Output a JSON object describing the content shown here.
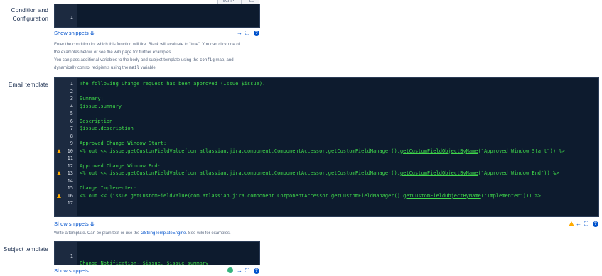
{
  "top_tabs": {
    "script": "SCRIPT",
    "file": "FILE"
  },
  "condition": {
    "label_line1": "Condition and",
    "label_line2": "Configuration",
    "line_number": "1",
    "show_snippets": "Show snippets",
    "hint_line1": "Enter the condition for which this function will fire. Blank will evaluate to \"true\". You can click one of",
    "hint_line2": "the examples below, or see the wiki page for further examples.",
    "hint_line3_pre": "You can pass additional variables to the body and subject template using the",
    "hint_line3_code": "config",
    "hint_line3_post": "map, and",
    "hint_line4_pre": "dynamically control recipients using the",
    "hint_line4_code": "mail",
    "hint_line4_post": "variable"
  },
  "email": {
    "label": "Email template",
    "lines": [
      {
        "n": "1",
        "text": "The following Change request has been approved (Issue $issue).",
        "warn": false
      },
      {
        "n": "2",
        "text": "",
        "warn": false
      },
      {
        "n": "3",
        "text": "Summary:",
        "warn": false
      },
      {
        "n": "4",
        "text": "$issue.summary",
        "warn": false
      },
      {
        "n": "5",
        "text": "",
        "warn": false
      },
      {
        "n": "6",
        "text": "Description:",
        "warn": false
      },
      {
        "n": "7",
        "text": "$issue.description",
        "warn": false
      },
      {
        "n": "8",
        "text": "",
        "warn": false
      },
      {
        "n": "9",
        "text": "Approved Change Window Start:",
        "warn": false
      },
      {
        "n": "10",
        "pre": "<% out << issue.getCustomFieldValue(com.atlassian.jira.component.ComponentAccessor.getCustomFieldManager().",
        "u": "getCustomFieldObjectByName",
        "post": "(\"Approved Window Start\")) %>",
        "warn": true
      },
      {
        "n": "11",
        "text": "",
        "warn": false
      },
      {
        "n": "12",
        "text": "Approved Change Window End:",
        "warn": false
      },
      {
        "n": "13",
        "pre": "<% out << issue.getCustomFieldValue(com.atlassian.jira.component.ComponentAccessor.getCustomFieldManager().",
        "u": "getCustomFieldObjectByName",
        "post": "(\"Approved Window End\")) %>",
        "warn": true
      },
      {
        "n": "14",
        "text": "",
        "warn": false
      },
      {
        "n": "15",
        "text": "Change Implementer:",
        "warn": false
      },
      {
        "n": "16",
        "pre": "<% out << (issue.getCustomFieldValue(com.atlassian.jira.component.ComponentAccessor.getCustomFieldManager().",
        "u": "getCustomFieldObjectByName",
        "post": "(\"Implementer\"))) %>",
        "warn": true
      },
      {
        "n": "17",
        "text": "",
        "warn": false
      }
    ],
    "show_snippets": "Show snippets",
    "hint_pre": "Write a template. Can be plain text or use the",
    "hint_link": "GStringTemplateEngine",
    "hint_post": ". See wiki for examples."
  },
  "subject": {
    "label": "Subject template",
    "line_number": "1",
    "code": "Change Notification- $issue, $issue.summary",
    "show_snippets": "Show snippets"
  },
  "icons": {
    "chevron": "double-chevron-down-icon",
    "arrow_right": "arrow-right-icon",
    "arrow_left": "arrow-left-icon",
    "expand": "expand-icon",
    "help": "help-icon",
    "warning": "warning-icon"
  },
  "colors": {
    "editor_bg": "#0d1b2e",
    "gutter_bg": "#1c2a40",
    "code_green": "#3fd84a",
    "link_blue": "#0052cc",
    "warning": "#ffab00"
  }
}
